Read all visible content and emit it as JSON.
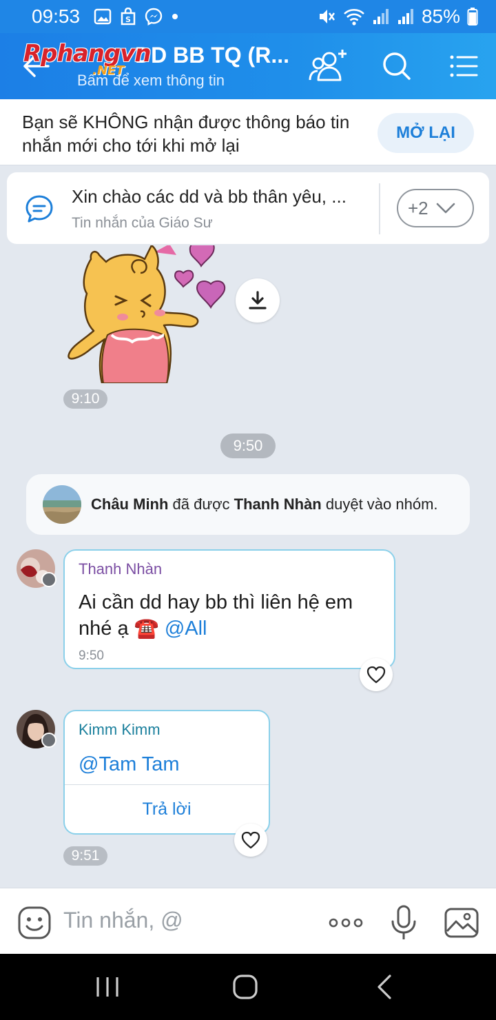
{
  "status_bar": {
    "time": "09:53",
    "battery": "85%"
  },
  "header": {
    "logo_text": "Rphangvn",
    "logo_net": ".NET",
    "group_name": "DD BB TQ (R...",
    "subtitle": "Bấm để xem thông tin"
  },
  "mute_banner": {
    "text": "Bạn sẽ KHÔNG nhận được thông báo tin nhắn mới cho tới khi mở lại",
    "reopen_label": "MỞ LẠI"
  },
  "pinned": {
    "title": "Xin chào các dd và bb thân yêu, ...",
    "subtitle": "Tin nhắn của Giáo Sư",
    "count": "+2"
  },
  "sticker": {
    "time": "9:10"
  },
  "date_divider": "9:50",
  "system_notice": {
    "member": "Châu Minh",
    "middle": " đã được ",
    "approver": "Thanh Nhàn",
    "end": " duyệt vào nhóm."
  },
  "messages": [
    {
      "sender": "Thanh Nhàn",
      "sender_color": "#7b4ea3",
      "line1": "Ai cần dd hay bb thì liên hệ em",
      "line2": "nhé ạ ☎️",
      "mention": "@All",
      "time": "9:50"
    },
    {
      "sender": "Kimm Kimm",
      "sender_color": "#1a7f9c",
      "mention": "@Tam Tam",
      "reply_label": "Trả lời",
      "time": "9:51"
    }
  ],
  "input": {
    "placeholder": "Tin nhắn, @"
  },
  "icons": {
    "back": "arrow-left-icon",
    "add_member": "add-user-icon",
    "search": "search-icon",
    "menu": "list-menu-icon",
    "pinned": "chat-bubble-icon",
    "download": "download-icon",
    "heart": "heart-icon",
    "emoji": "emoji-icon",
    "more": "more-dots-icon",
    "mic": "microphone-icon",
    "image": "image-icon"
  },
  "colors": {
    "header_blue": "#1f86e6",
    "accent": "#1d7fd9",
    "chat_bg": "#e3e8ef"
  }
}
